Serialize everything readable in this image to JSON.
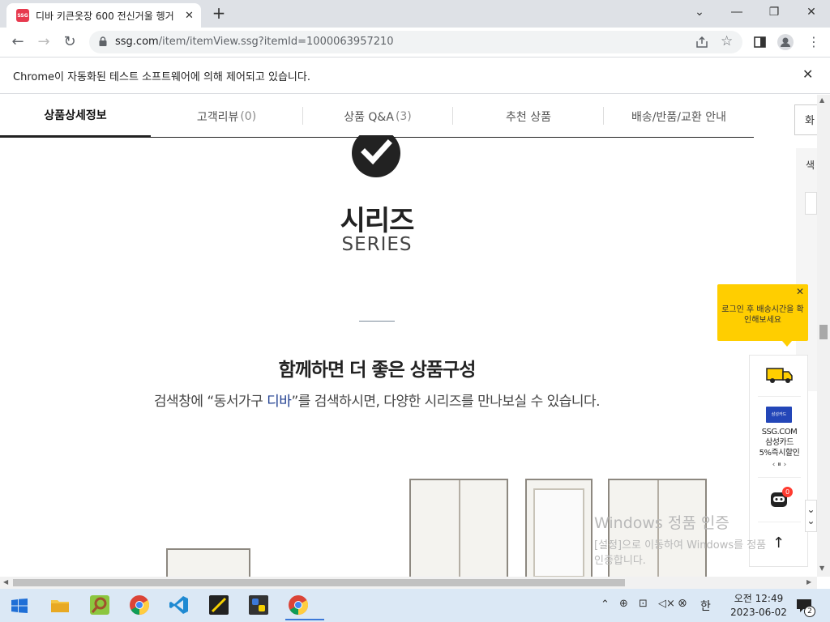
{
  "browser": {
    "tab_title": "디바 키큰옷장 600 전신거울 헹거",
    "tab_favicon": "SSG",
    "url_host": "ssg.com",
    "url_path": "/item/itemView.ssg?itemId=1000063957210",
    "infobar_text": "Chrome이 자동화된 테스트 소프트웨어에 의해 제어되고 있습니다."
  },
  "product_tabs": [
    {
      "label": "상품상세정보",
      "count": ""
    },
    {
      "label": "고객리뷰",
      "count": "(0)"
    },
    {
      "label": "상품 Q&A",
      "count": "(3)"
    },
    {
      "label": "추천 상품",
      "count": ""
    },
    {
      "label": "배송/반품/교환 안내",
      "count": ""
    }
  ],
  "content": {
    "series_ko": "시리즈",
    "series_en": "SERIES",
    "headline": "함께하면 더 좋은 상품구성",
    "sub_before": "검색창에 “동서가구 ",
    "sub_brand": "디바",
    "sub_after": "”를 검색하시면, 다양한 시리즈를 만나보실 수 있습니다."
  },
  "side": {
    "tab_label": "화",
    "panel_label": "색",
    "tooltip_text": "로그인 후 배송시간을 확인해보세요",
    "promo_line1": "SSG.COM",
    "promo_line2": "삼성카드",
    "promo_line3": "5%즉시할인",
    "promo_controls": "‹  ⏸  ›",
    "card_label": "삼성카드",
    "bot_badge": "0"
  },
  "watermark": {
    "line1": "Windows 정품 인증",
    "line2": "[설정]으로 이동하여 Windows를 정품",
    "line3": "인증합니다."
  },
  "taskbar": {
    "ime": "한",
    "time": "오전 12:49",
    "date": "2023-06-02",
    "notifications": "2"
  }
}
